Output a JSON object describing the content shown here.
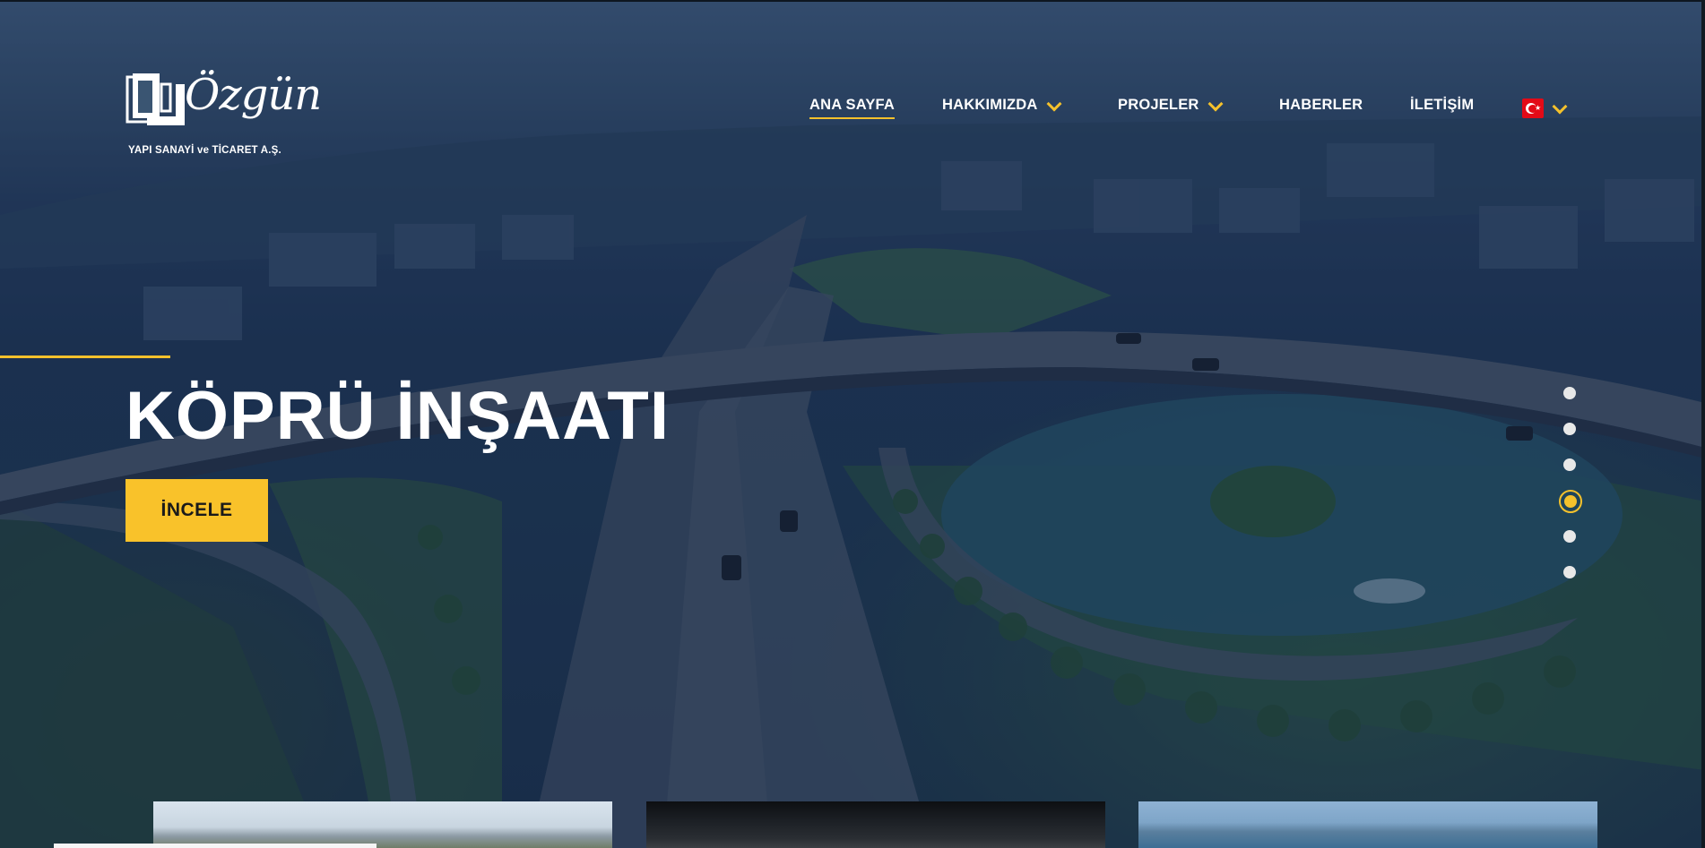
{
  "brand": {
    "name": "Özgün",
    "subtitle": "YAPI SANAYİ ve TİCARET A.Ş."
  },
  "nav": {
    "items": [
      {
        "label": "ANA SAYFA",
        "active": true,
        "has_dropdown": false
      },
      {
        "label": "HAKKIMIZDA",
        "active": false,
        "has_dropdown": true
      },
      {
        "label": "PROJELER",
        "active": false,
        "has_dropdown": true
      },
      {
        "label": "HABERLER",
        "active": false,
        "has_dropdown": false
      },
      {
        "label": "İLETİŞİM",
        "active": false,
        "has_dropdown": false
      }
    ],
    "language": {
      "icon": "turkey-flag-icon",
      "has_dropdown": true
    }
  },
  "hero": {
    "title": "KÖPRÜ İNŞAATI",
    "cta_label": "İNCELE"
  },
  "slider": {
    "total": 6,
    "active_index": 4
  },
  "colors": {
    "accent": "#f4c12c",
    "overlay": "#0e2246",
    "button": "#f9c22a"
  }
}
